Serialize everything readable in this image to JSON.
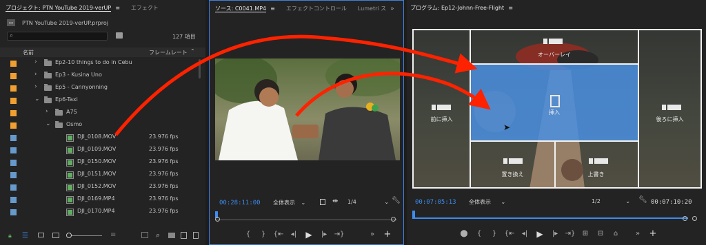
{
  "project_panel": {
    "tab_label": "プロジェクト: PTN YouTube 2019-verUP",
    "tab_effects": "エフェクト",
    "project_file": "PTN YouTube 2019-verUP.prproj",
    "item_count": "127 項目",
    "col_name": "名前",
    "col_framerate": "フレームレート",
    "rows": [
      {
        "label": "Ep2-10 things to do in Cebu",
        "type": "folder",
        "fps": "",
        "swatch": "#f0a030"
      },
      {
        "label": "Ep3 - Kusina Uno",
        "type": "folder",
        "fps": "",
        "swatch": "#f0a030"
      },
      {
        "label": "Ep5 - Cannyonning",
        "type": "folder",
        "fps": "",
        "swatch": "#f0a030"
      },
      {
        "label": "Ep6-Taxi",
        "type": "folder",
        "fps": "",
        "swatch": "#f0a030"
      },
      {
        "label": "A7S",
        "type": "folder",
        "fps": "",
        "swatch": "#f0a030"
      },
      {
        "label": "Osmo",
        "type": "folder",
        "fps": "",
        "swatch": "#f0a030"
      },
      {
        "label": "DJI_0108.MOV",
        "type": "clip",
        "fps": "23.976 fps",
        "swatch": "#6699cc"
      },
      {
        "label": "DJI_0109.MOV",
        "type": "clip",
        "fps": "23.976 fps",
        "swatch": "#6699cc"
      },
      {
        "label": "DJI_0150.MOV",
        "type": "clip",
        "fps": "23.976 fps",
        "swatch": "#6699cc"
      },
      {
        "label": "DJI_0151.MOV",
        "type": "clip",
        "fps": "23.976 fps",
        "swatch": "#6699cc"
      },
      {
        "label": "DJI_0152.MOV",
        "type": "clip",
        "fps": "23.976 fps",
        "swatch": "#6699cc"
      },
      {
        "label": "DJI_0169.MP4",
        "type": "clip",
        "fps": "23.976 fps",
        "swatch": "#6699cc"
      },
      {
        "label": "DJI_0170.MP4",
        "type": "clip",
        "fps": "23.976 fps",
        "swatch": "#6699cc"
      }
    ]
  },
  "source_panel": {
    "tab_label": "ソース: C0041.MP4",
    "tab_effect_controls": "エフェクトコントロール",
    "tab_lumetri": "Lumetri ス",
    "timecode": "00:28:11:00",
    "zoom": "全体表示",
    "resolution": "1/4"
  },
  "program_panel": {
    "tab_label": "プログラム: Ep12-Johnn-Free-Flight",
    "timecode": "00:07:05:13",
    "zoom": "全体表示",
    "resolution": "1/2",
    "duration": "00:07:10:20",
    "drop_zones": {
      "overlay": "オーバーレイ",
      "insert_before": "前に挿入",
      "insert": "挿入",
      "insert_after": "後ろに挿入",
      "replace": "置き換え",
      "overwrite": "上書き"
    }
  },
  "colors": {
    "accent": "#3d8cf0",
    "arrow": "#ff2200",
    "folder_label": "#f0a030",
    "clip_label": "#6699cc",
    "insert_zone": "#4a8fe0"
  }
}
